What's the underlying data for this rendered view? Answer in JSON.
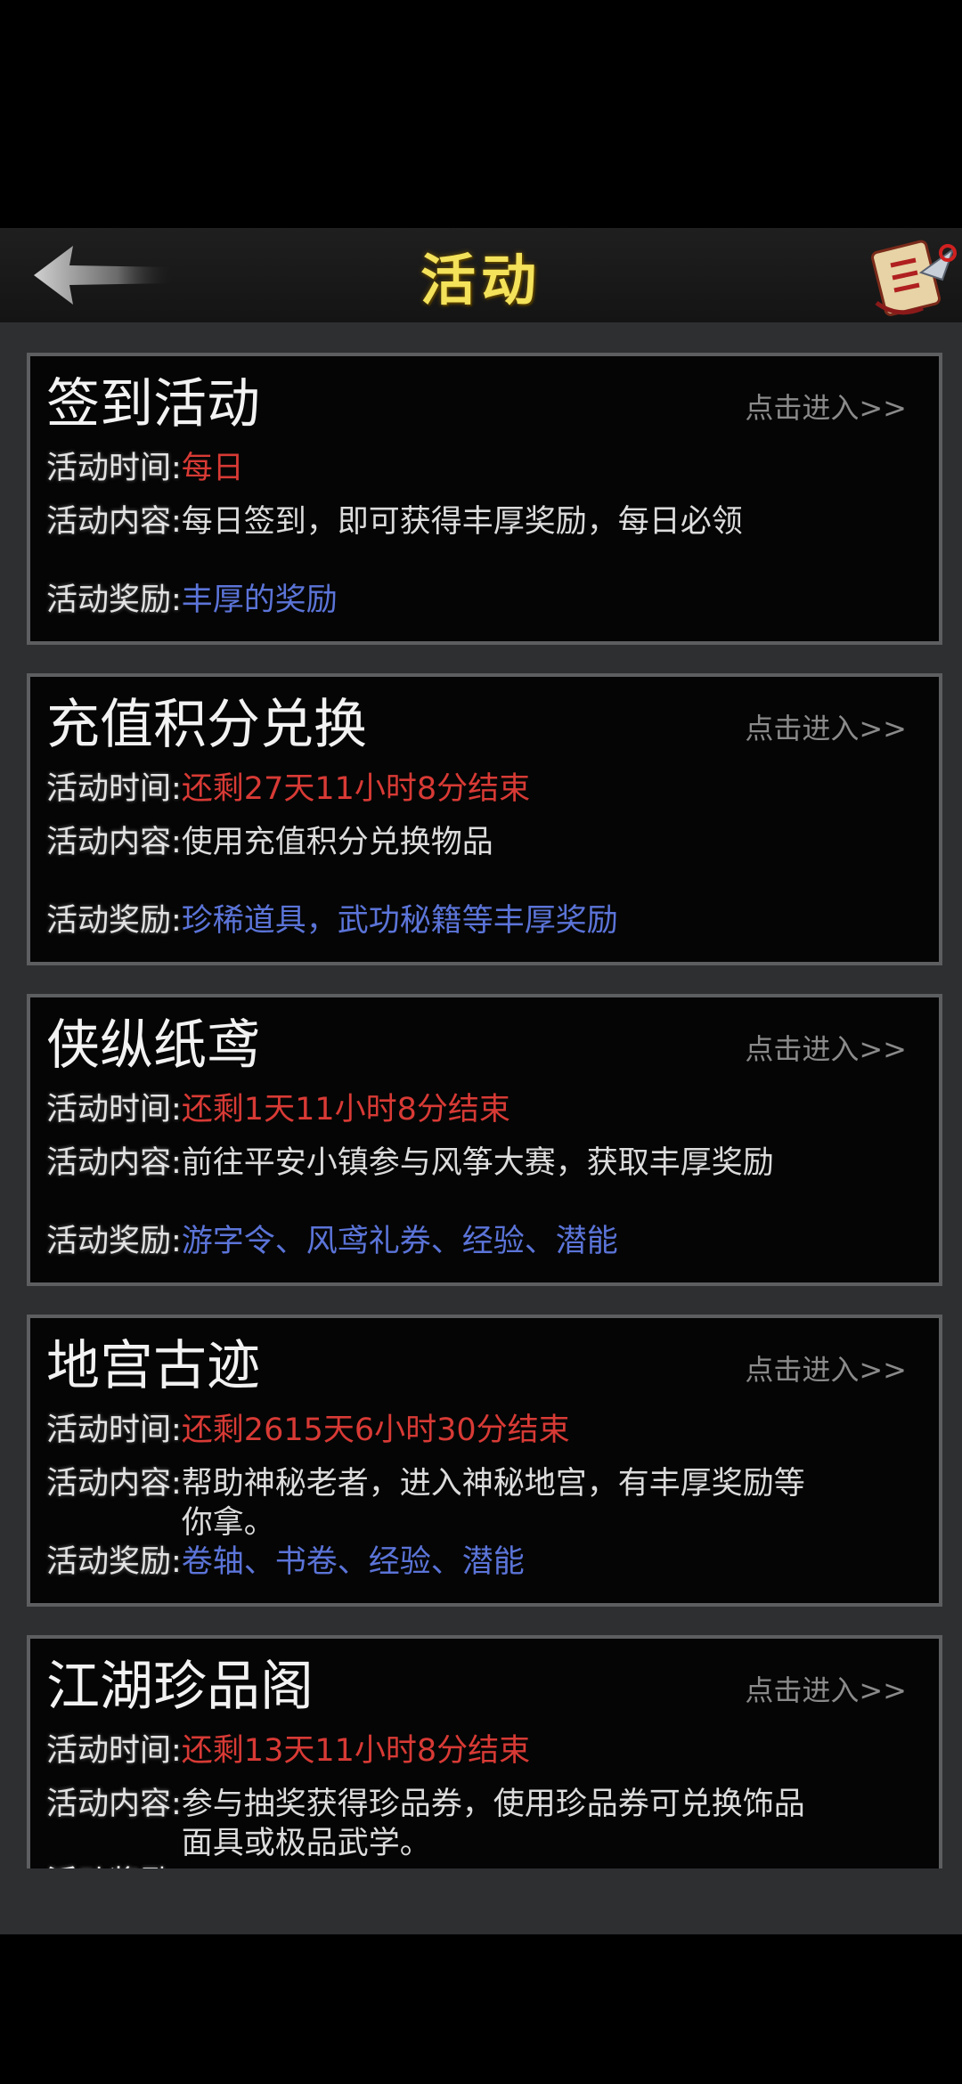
{
  "header": {
    "title": "活动",
    "back_icon": "back-arrow-icon",
    "right_icon": "scroll-icon"
  },
  "labels": {
    "time": "活动时间:",
    "content": "活动内容:",
    "reward": "活动奖励:"
  },
  "activities": [
    {
      "title": "签到活动",
      "enter": "点击进入>>",
      "time": "每日",
      "content": "每日签到，即可获得丰厚奖励，每日必领",
      "reward": "丰厚的奖励"
    },
    {
      "title": "充值积分兑换",
      "enter": "点击进入>>",
      "time": "还剩27天11小时8分结束",
      "content": "使用充值积分兑换物品",
      "reward": "珍稀道具，武功秘籍等丰厚奖励"
    },
    {
      "title": "侠纵纸鸢",
      "enter": "点击进入>>",
      "time": "还剩1天11小时8分结束",
      "content": "前往平安小镇参与风筝大赛，获取丰厚奖励",
      "reward": "游字令、风鸢礼券、经验、潜能"
    },
    {
      "title": "地宫古迹",
      "enter": "点击进入>>",
      "time": "还剩2615天6小时30分结束",
      "content": "帮助神秘老者，进入神秘地宫，有丰厚奖励等你拿。",
      "reward": "卷轴、书卷、经验、潜能"
    },
    {
      "title": "江湖珍品阁",
      "enter": "点击进入>>",
      "time": "还剩13天11小时8分结束",
      "content": "参与抽奖获得珍品券，使用珍品券可兑换饰品面具或极品武学。",
      "reward": ""
    }
  ],
  "colors": {
    "title_yellow": "#f3e25a",
    "time_red": "#d83a35",
    "reward_blue": "#5b74d8"
  }
}
